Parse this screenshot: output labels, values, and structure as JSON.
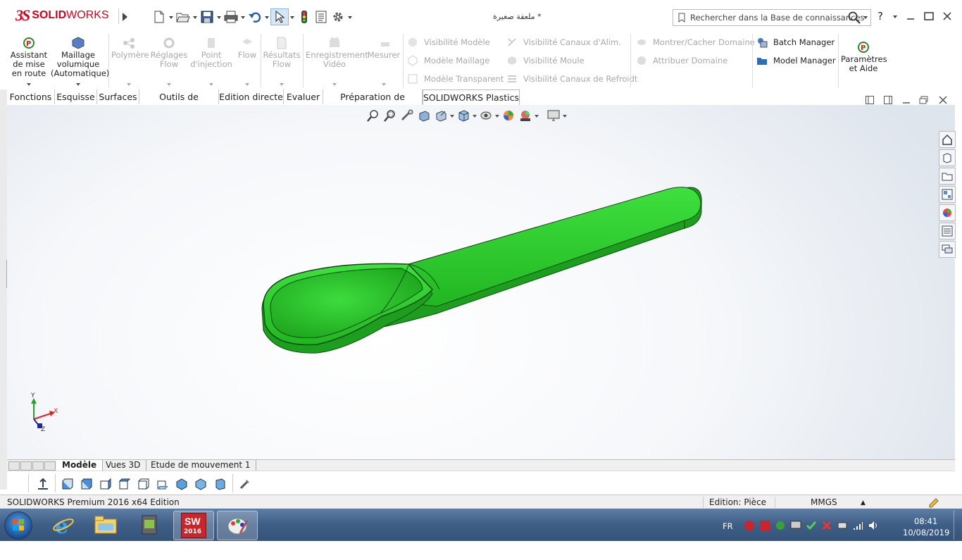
{
  "app": {
    "logo_ds": "3S",
    "logo_solid": "SOLID",
    "logo_works": "WORKS",
    "doc_title": "ملعقة صغيرة *"
  },
  "search": {
    "placeholder": "Rechercher dans la Base de connaissances",
    "help": "?"
  },
  "ribbon": {
    "wizard": "Assistant de mise en route",
    "mesh": "Maillage volumique (Automatique)",
    "polymer": "Polymère",
    "flow_settings": "Réglages Flow",
    "injection_point": "Point d'injection",
    "flow": "Flow",
    "flow_results": "Résultats Flow",
    "video_record": "Enregistrement Vidéo",
    "measure": "Mesurer",
    "model_visibility": "Visibilité Modèle",
    "mesh_model": "Modèle Maillage",
    "transparent_model": "Modèle Transparent",
    "runner_visibility": "Visibilité Canaux d'Alim.",
    "mold_visibility": "Visibilité Moule",
    "cooling_visibility": "Visibilité Canaux de Refroidt",
    "show_hide_domain": "Montrer/Cacher Domaine",
    "assign_domain": "Attribuer Domaine",
    "batch_manager": "Batch Manager",
    "model_manager": "Model Manager",
    "settings_help": "Paramètres et Aide"
  },
  "tabs": [
    "Fonctions",
    "Esquisse",
    "Surfaces",
    "Outils de moulage",
    "Edition directe",
    "Evaluer",
    "Préparation de l'analyse",
    "SOLIDWORKS Plastics"
  ],
  "active_tab": "SOLIDWORKS Plastics",
  "triad": {
    "x": "X",
    "y": "Y",
    "z": "Z"
  },
  "bottom_tabs": [
    "Modèle",
    "Vues 3D",
    "Etude de mouvement 1"
  ],
  "status": {
    "edition": "SOLIDWORKS Premium 2016 x64 Edition",
    "mode": "Edition: Pièce",
    "units": "MMGS"
  },
  "taskbar": {
    "sw_label": "2016",
    "lang": "FR",
    "time": "08:41",
    "date": "10/08/2019"
  },
  "colors": {
    "brand": "#d6001c",
    "part": "#2ec62e",
    "part_edge": "#0d4a0d"
  }
}
